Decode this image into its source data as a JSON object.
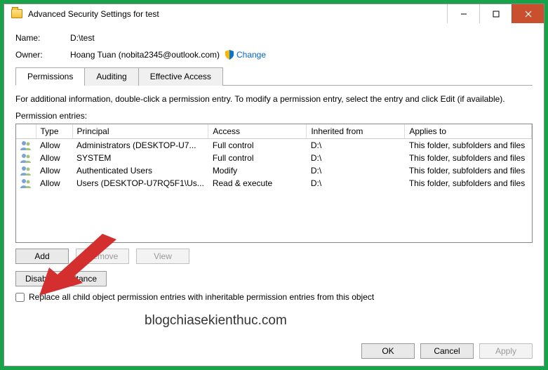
{
  "window": {
    "title": "Advanced Security Settings for test"
  },
  "info": {
    "name_label": "Name:",
    "name_value": "D:\\test",
    "owner_label": "Owner:",
    "owner_value": "Hoang Tuan (nobita2345@outlook.com)",
    "change_link": "Change"
  },
  "tabs": {
    "permissions": "Permissions",
    "auditing": "Auditing",
    "effective": "Effective Access"
  },
  "hint": "For additional information, double-click a permission entry. To modify a permission entry, select the entry and click Edit (if available).",
  "entries_label": "Permission entries:",
  "columns": {
    "type": "Type",
    "principal": "Principal",
    "access": "Access",
    "inherited": "Inherited from",
    "applies": "Applies to"
  },
  "rows": [
    {
      "type": "Allow",
      "principal": "Administrators (DESKTOP-U7...",
      "access": "Full control",
      "inherited": "D:\\",
      "applies": "This folder, subfolders and files"
    },
    {
      "type": "Allow",
      "principal": "SYSTEM",
      "access": "Full control",
      "inherited": "D:\\",
      "applies": "This folder, subfolders and files"
    },
    {
      "type": "Allow",
      "principal": "Authenticated Users",
      "access": "Modify",
      "inherited": "D:\\",
      "applies": "This folder, subfolders and files"
    },
    {
      "type": "Allow",
      "principal": "Users (DESKTOP-U7RQ5F1\\Us...",
      "access": "Read & execute",
      "inherited": "D:\\",
      "applies": "This folder, subfolders and files"
    }
  ],
  "buttons": {
    "add": "Add",
    "remove": "Remove",
    "view": "View",
    "disable_inherit": "Disable inheritance",
    "ok": "OK",
    "cancel": "Cancel",
    "apply": "Apply"
  },
  "checkbox_label": "Replace all child object permission entries with inheritable permission entries from this object",
  "watermark": "blogchiasekienthuc.com"
}
